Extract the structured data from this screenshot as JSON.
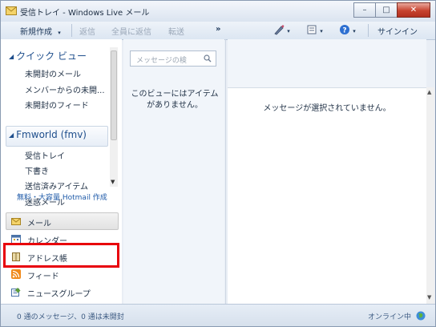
{
  "window": {
    "title": "受信トレイ - Windows Live メール",
    "minimize_glyph": "–",
    "maximize_glyph": "□",
    "close_glyph": "✕"
  },
  "toolbar": {
    "new_label": "新規作成",
    "new_arrow": "▾",
    "reply_label": "返信",
    "reply_all_label": "全員に返信",
    "forward_label": "転送",
    "more_label": "»",
    "signin_label": "サインイン",
    "dropdown_arrow": "▾"
  },
  "folder_pane": {
    "quick_views": {
      "arrow": "◢",
      "title": "クイック ビュー",
      "items": [
        "未開封のメール",
        "メンバーからの未開...",
        "未開封のフィード"
      ]
    },
    "account": {
      "arrow": "◢",
      "title": "Fmworld (fmv)",
      "items": [
        "受信トレイ",
        "下書き",
        "送信済みアイテム",
        "迷惑メール"
      ]
    },
    "hotmail_link": "無料・大容量 Hotmail 作成",
    "scroll_down_glyph": "▼"
  },
  "nav": {
    "items": [
      {
        "label": "メール",
        "icon": "mail-icon"
      },
      {
        "label": "カレンダー",
        "icon": "calendar-icon"
      },
      {
        "label": "アドレス帳",
        "icon": "address-book-icon"
      },
      {
        "label": "フィード",
        "icon": "rss-feed-icon"
      },
      {
        "label": "ニュースグループ",
        "icon": "newsgroup-icon"
      }
    ],
    "selected": "メール",
    "highlighted": "アドレス帳",
    "highlight_color": "#e8000b"
  },
  "message_list": {
    "search_placeholder": "メッセージの検",
    "empty_line1": "このビューにはアイテム",
    "empty_line2": "がありません。"
  },
  "reading_pane": {
    "empty_text": "メッセージが選択されていません。",
    "scroll_up_glyph": "▲",
    "scroll_down_glyph": "▼"
  },
  "status": {
    "left": "0 通のメッセージ、0 通は未開封",
    "right": "オンライン中"
  },
  "colors": {
    "accent": "#1e4e8c",
    "link": "#1e5aa8",
    "close_button": "#c7432f"
  }
}
